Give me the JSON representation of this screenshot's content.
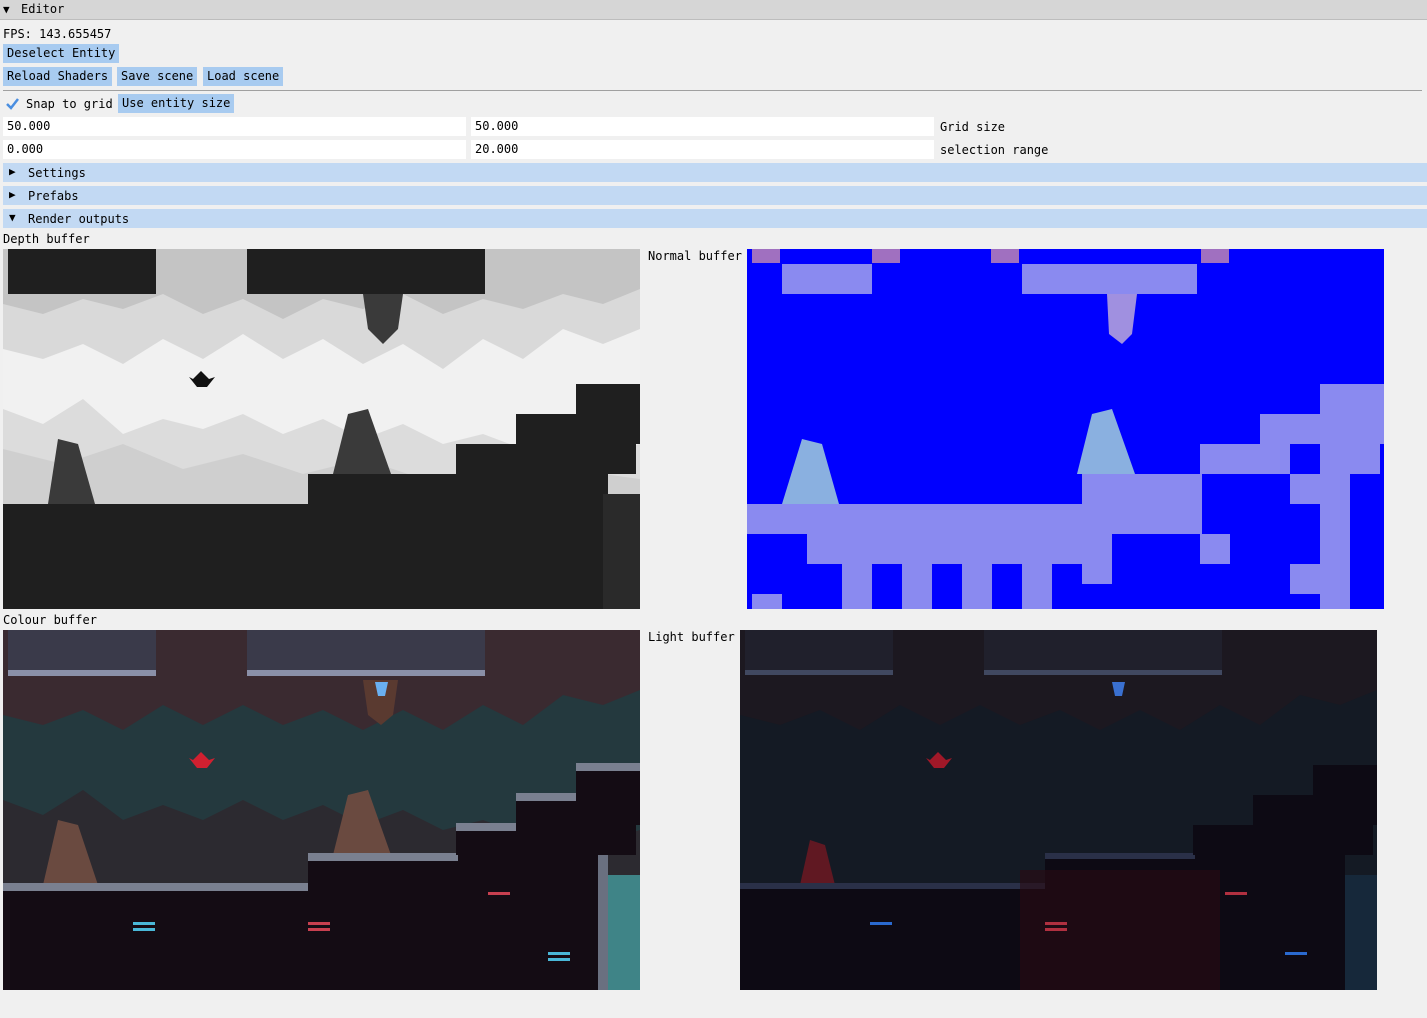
{
  "window": {
    "title": "Editor",
    "collapse_icon": "triangle-down-icon"
  },
  "stats": {
    "fps": "FPS: 143.655457"
  },
  "buttons": {
    "deselect_entity": "Deselect Entity",
    "reload_shaders": "Reload Shaders",
    "save_scene": "Save scene",
    "load_scene": "Load scene",
    "use_entity_size": "Use entity size"
  },
  "snap": {
    "label": "Snap to grid",
    "checked": true
  },
  "grid_size": {
    "x": "50.000",
    "y": "50.000",
    "label": "Grid size"
  },
  "selection_range": {
    "a": "0.000",
    "b": "20.000",
    "label": "selection range"
  },
  "sections": {
    "settings": {
      "label": "Settings",
      "open": false
    },
    "prefabs": {
      "label": "Prefabs",
      "open": false
    },
    "render_outputs": {
      "label": "Render outputs",
      "open": true
    }
  },
  "outputs": {
    "depth": "Depth buffer",
    "normal": "Normal buffer",
    "colour": "Colour buffer",
    "light": "Light buffer"
  },
  "colors": {
    "button": "#a8cbf0",
    "header": "#c2d9f3",
    "normal_bg": "#0000ff",
    "normal_tile": "#8a8af0",
    "colour_bg": "#24393e",
    "colour_ground": "#140c14",
    "water": "#3f8487"
  }
}
